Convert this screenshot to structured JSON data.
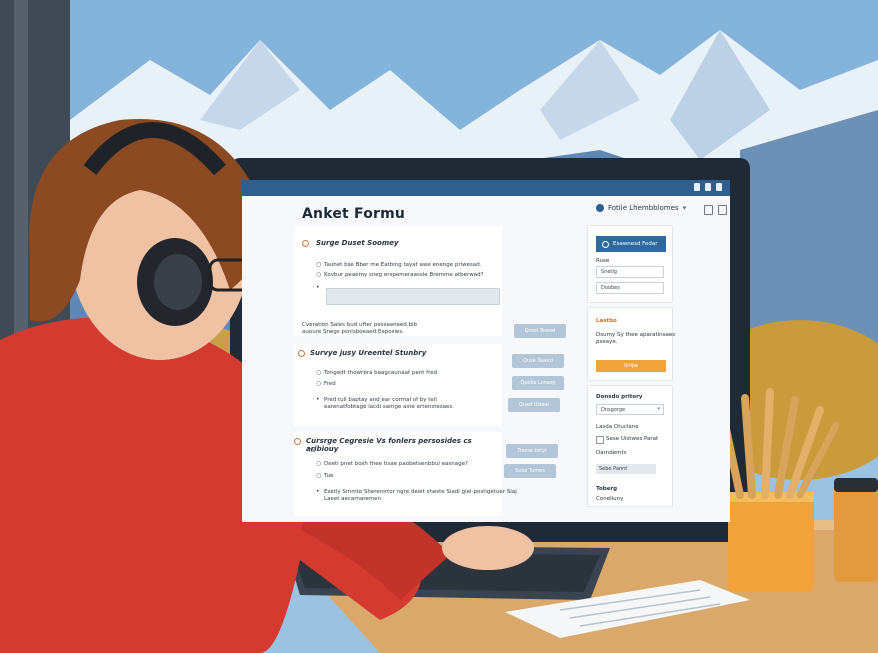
{
  "screen": {
    "title": "Anket Formu",
    "user_name": "Fotile Lhembblomes",
    "user_menu_chevron": "▾",
    "topbar_icons": [
      "bell-icon",
      "info-icon",
      "settings-icon"
    ],
    "sections": [
      {
        "heading": "Surge Duset Soomey",
        "lines": [
          "Tauhet bse Bber me Eatbing tayat awe enenge priwesad.",
          "Kovbur peaemy sneg erspemeraassle Bremme atberwad?"
        ],
        "button": "Qood Tewed"
      },
      {
        "heading": "Survye jusy Ureentel Stunbry",
        "intro": [
          "Cveration Sales bud ufter pessawtaed bib",
          "auoure Snegs psnlsboeaed Eeposies."
        ],
        "lines": [
          "Tongedt thowrbra baagcaunaat pent fred",
          "Fred",
          "Pred tull baptay and ear cormal of by tell",
          "earenatfobtage lacdi samge aste ertenstesaes."
        ],
        "buttons": [
          "Quse Tewed",
          "Quoke Lonasy",
          "Qued Uiseal"
        ]
      },
      {
        "heading": "Cursrge Cegresie Vs fonlers persosides cs aribiouy",
        "sub": "Tui",
        "lines": [
          "Deeti pnet bosh thee tisae paobetsenbbul easnage?",
          "Tue",
          "Esetly Smmte Sherenirtor ngre deiet sheste Siadi giel-postigetuer Siaj",
          "Laeet aecarnaremen"
        ],
        "buttons": [
          "Tresse bstyl",
          "Suse Tumes"
        ]
      }
    ],
    "right_panel": {
      "primary_button": "Esawnesd Fedar",
      "field_label": "Ruse",
      "fields": [
        "Snetlg",
        "Doobes"
      ],
      "block_title": "Lastbo",
      "block_text": [
        "Dsumy Sy thee aparatinsaes",
        "pseaye."
      ],
      "orange_button": "Srilpe",
      "dropdown_label": "Donsdo pritory",
      "dropdown_value": "Dnsgorge",
      "check_title": "Lasda Otuclane",
      "check_label": "Sese Uistwes Parat",
      "small_label": "Darndemts",
      "fill_value": "Sebe Pannt",
      "footer_title": "Toberg",
      "footer_text": "Coneliuny"
    }
  },
  "colors": {
    "topbar": "#2f5f8f",
    "accent_orange": "#f0a33a",
    "sweater_red": "#d43a2f",
    "sky": "#9ec3e0"
  }
}
